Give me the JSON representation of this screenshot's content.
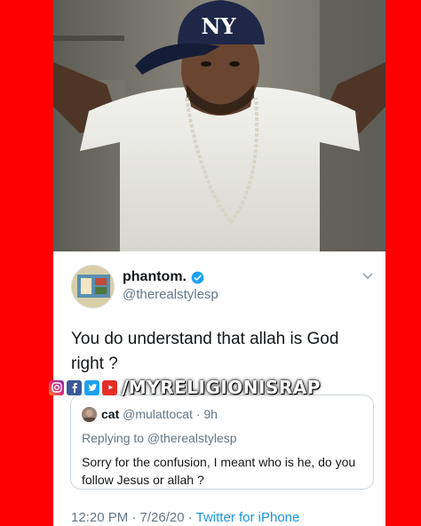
{
  "photo": {
    "cap_logo": "NY"
  },
  "tweet": {
    "display_name": "phantom.",
    "handle": "@therealstylesp",
    "text": "You do understand that allah is God right ?",
    "quoted": {
      "name": "cat",
      "handle": "@mulattocat",
      "separator": "·",
      "time": "9h",
      "replying_to": "Replying to @therealstylesp",
      "text": "Sorry for the confusion, I meant who is he, do you follow Jesus or allah ?"
    },
    "timestamp": "12:20 PM · 7/26/20 · ",
    "source": "Twitter for iPhone"
  },
  "watermark": {
    "text": "/MYRELIGIONISRAP",
    "icons": [
      "instagram-icon",
      "facebook-icon",
      "twitter-icon",
      "youtube-icon"
    ]
  },
  "colors": {
    "border": "#ff0000",
    "verified": "#1da1f2",
    "link": "#1b95e0",
    "secondary_text": "#657786"
  }
}
